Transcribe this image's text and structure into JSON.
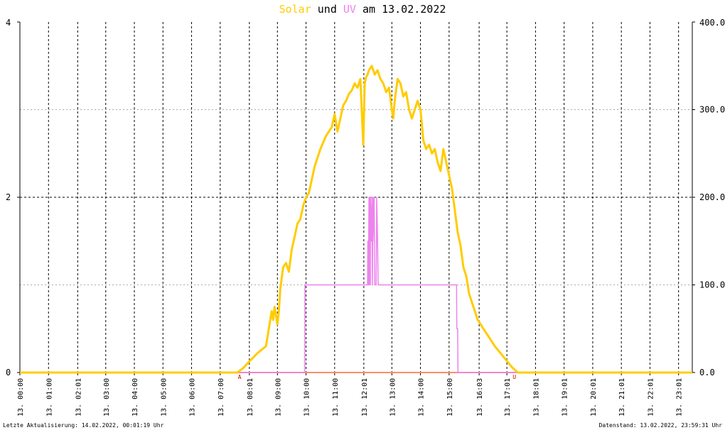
{
  "title": {
    "solar": "Solar",
    "und": "und",
    "uv": "UV",
    "am": "am",
    "date": "13.02.2022",
    "solar_color": "#ffcc00",
    "uv_color": "#ee82ee"
  },
  "footer": {
    "left": "Letzte Aktualisierung: 14.02.2022, 00:01:19 Uhr",
    "right": "Datenstand: 13.02.2022, 23:59:31 Uhr"
  },
  "chart_data": {
    "type": "line",
    "x_ticks": [
      "13. 00:00",
      "13. 01:00",
      "13. 02:01",
      "13. 03:00",
      "13. 04:00",
      "13. 05:00",
      "13. 06:00",
      "13. 07:00",
      "13. 08:01",
      "13. 09:00",
      "13. 10:00",
      "13. 11:00",
      "13. 12:01",
      "13. 13:00",
      "13. 14:00",
      "13. 15:00",
      "13. 16:03",
      "13. 17:01",
      "13. 18:01",
      "13. 19:01",
      "13. 20:01",
      "13. 21:01",
      "13. 22:01",
      "13. 23:01"
    ],
    "x_tick_hours": [
      0,
      1,
      2.02,
      3,
      4,
      5,
      6,
      7,
      8.02,
      9,
      10,
      11,
      12.02,
      13,
      14,
      15,
      16.05,
      17.02,
      18.02,
      19.02,
      20.02,
      21.02,
      22.02,
      23.02
    ],
    "y_left_ticks": [
      "0",
      "2",
      "4"
    ],
    "y_left_ticks_faint": [
      1,
      3
    ],
    "y_left_range": [
      0,
      4
    ],
    "y_right_ticks": [
      "0.0",
      "100.0",
      "200.0",
      "300.0",
      "400.0"
    ],
    "y_right_range": [
      0,
      400
    ],
    "x_range_hours": [
      0,
      23.5
    ],
    "markers": [
      {
        "label": "A",
        "hour": 7.67
      },
      {
        "label": "U",
        "hour": 17.27
      }
    ],
    "series": [
      {
        "name": "UV",
        "color": "#ee82ee",
        "axis": "left",
        "x": [
          0,
          9.95,
          9.96,
          12.15,
          12.16,
          12.18,
          12.2,
          12.22,
          12.22,
          12.25,
          12.25,
          12.28,
          12.3,
          12.32,
          12.34,
          12.34,
          12.38,
          12.4,
          12.45,
          12.47,
          12.5,
          12.52,
          12.55,
          12.57,
          15.26,
          15.27,
          15.3,
          15.31,
          23.5
        ],
        "values": [
          0,
          0,
          1,
          1,
          1.5,
          1,
          2,
          1,
          2,
          1,
          2,
          1.5,
          2,
          1,
          2,
          1.5,
          2,
          1,
          1,
          2,
          1.5,
          1,
          1,
          1,
          1,
          0.5,
          0.5,
          0,
          0
        ]
      },
      {
        "name": "Solar",
        "color": "#ffcc00",
        "axis": "right",
        "x": [
          0,
          7.6,
          7.8,
          8.0,
          8.3,
          8.6,
          8.8,
          8.85,
          8.9,
          9.0,
          9.05,
          9.1,
          9.2,
          9.3,
          9.4,
          9.5,
          9.6,
          9.7,
          9.8,
          9.9,
          10.0,
          10.1,
          10.2,
          10.3,
          10.5,
          10.7,
          10.9,
          11.0,
          11.1,
          11.2,
          11.3,
          11.4,
          11.5,
          11.6,
          11.7,
          11.8,
          11.9,
          12.0,
          12.05,
          12.1,
          12.15,
          12.2,
          12.3,
          12.4,
          12.5,
          12.6,
          12.7,
          12.8,
          12.9,
          13.0,
          13.05,
          13.1,
          13.2,
          13.3,
          13.4,
          13.5,
          13.6,
          13.7,
          13.8,
          13.9,
          14.0,
          14.1,
          14.2,
          14.3,
          14.4,
          14.5,
          14.6,
          14.7,
          14.8,
          14.9,
          15.0,
          15.1,
          15.2,
          15.3,
          15.4,
          15.5,
          15.6,
          15.7,
          15.8,
          15.9,
          16.0,
          16.2,
          16.4,
          16.6,
          16.8,
          17.0,
          17.2,
          17.3,
          17.4,
          23.5
        ],
        "values": [
          0,
          0,
          5,
          12,
          22,
          30,
          70,
          60,
          75,
          55,
          70,
          95,
          120,
          125,
          115,
          140,
          155,
          170,
          175,
          190,
          200,
          205,
          220,
          235,
          255,
          270,
          280,
          295,
          275,
          290,
          305,
          310,
          318,
          322,
          330,
          325,
          335,
          260,
          330,
          337,
          340,
          345,
          350,
          340,
          345,
          335,
          330,
          320,
          325,
          300,
          290,
          310,
          335,
          330,
          315,
          320,
          300,
          290,
          300,
          310,
          300,
          265,
          255,
          260,
          250,
          255,
          240,
          230,
          255,
          240,
          225,
          210,
          185,
          160,
          145,
          120,
          110,
          90,
          80,
          70,
          60,
          50,
          40,
          30,
          22,
          14,
          6,
          3,
          0,
          0
        ]
      }
    ]
  }
}
